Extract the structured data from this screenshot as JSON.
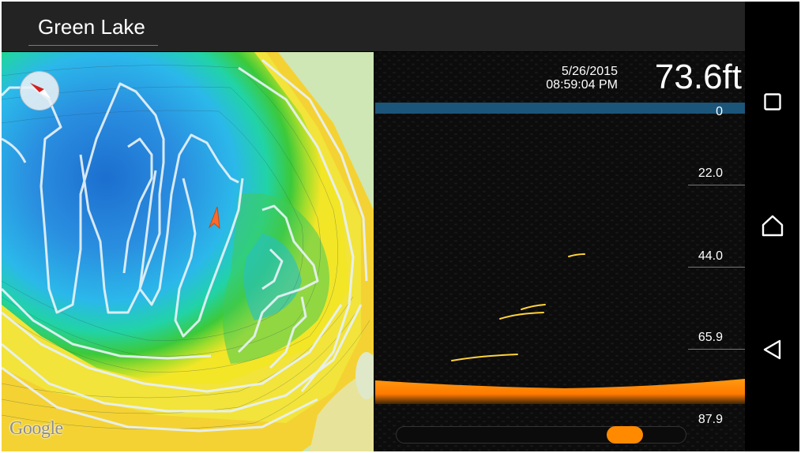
{
  "app": {
    "title": "Green Lake"
  },
  "map": {
    "attribution": "Google"
  },
  "sonar": {
    "date": "5/26/2015",
    "time": "08:59:04 PM",
    "depth_readout": "73.6ft",
    "depth_ticks": [
      "0",
      "22.0",
      "44.0",
      "65.9",
      "87.9"
    ],
    "slider_value_fraction": 0.83,
    "bottom_color": "#ff8a00"
  },
  "navbar": {
    "recents_icon": "square-recents-icon",
    "home_icon": "home-icon",
    "back_icon": "triangle-back-icon"
  }
}
